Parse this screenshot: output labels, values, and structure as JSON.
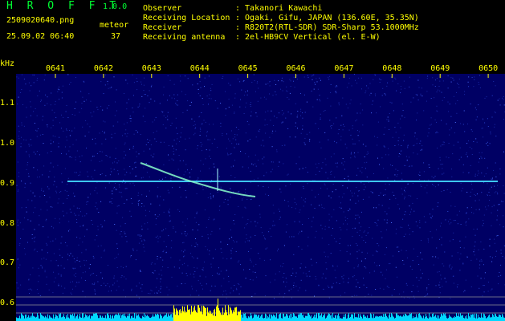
{
  "header": {
    "app_name": "H R O F F T",
    "version": "1.0.0",
    "filename": "2509020640.png",
    "datetime": "25.09.02 06:40",
    "meteor_label": "meteor",
    "meteor_count": "37",
    "info": [
      {
        "key": "Observer",
        "value": ": Takanori Kawachi"
      },
      {
        "key": "Receiving Location",
        "value": ": Ogaki, Gifu, JAPAN (136.60E, 35.35N)"
      },
      {
        "key": "Receiver",
        "value": ": R820T2(RTL-SDR) SDR-Sharp 53.1000MHz"
      },
      {
        "key": "Receiving antenna",
        "value": ": 2el-HB9CV Vertical (el. E-W)"
      }
    ]
  },
  "spectrogram": {
    "unit_label": "kHz",
    "time_ticks": [
      "0641",
      "0642",
      "0643",
      "0644",
      "0645",
      "0646",
      "0647",
      "0648",
      "0649",
      "0650"
    ],
    "freq_ticks": [
      "1.1",
      "1.0",
      "0.9",
      "0.8",
      "0.7",
      "0.6"
    ],
    "colors": {
      "background": "#000064",
      "carrier": "#44ddff",
      "trace": "#88ffcc",
      "power": "#00d8ff",
      "power_peak": "#ffff00",
      "text": "#ffff00"
    }
  }
}
